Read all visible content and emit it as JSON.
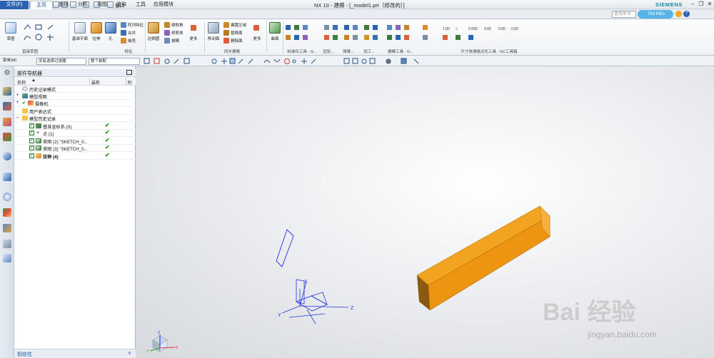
{
  "titlebar": {
    "logo": "NX",
    "title": "NX 10 - 建模 - [_model1.prt（修改的）]",
    "brand": "SIEMENS",
    "window_menu": "窗口"
  },
  "tabs": [
    "文件(F)",
    "主页",
    "曲线",
    "分析",
    "视图",
    "渲染",
    "工具",
    "应用模块"
  ],
  "command_finder_placeholder": "查找命令",
  "net_speed": "763 KB/s",
  "ribbon": {
    "sketch_group": {
      "items": [
        "草图"
      ],
      "label": "直接草图"
    },
    "feature_group": {
      "big": [
        "基准平面",
        "拉伸",
        "孔"
      ],
      "small": [
        "阵列特征",
        "合并",
        "抽壳"
      ],
      "label": "特征"
    },
    "sync_group": {
      "big": [
        "边倒圆",
        "移动面",
        "更多"
      ],
      "small": [
        "倒斜角",
        "修剪体",
        "拔模",
        "偏置区域",
        "替换面",
        "删除面"
      ],
      "label": "同步建模"
    },
    "surface_group": {
      "big": [
        "曲面",
        "更多"
      ]
    },
    "group_labels": [
      "标准化工具 - G...",
      "齿轮...",
      "弹簧...",
      "加工...",
      "建模工具 - G...",
      "尺寸快速格式化工具 - GC工具箱"
    ]
  },
  "toolbar": {
    "menu_label": "菜单(M)",
    "filter_value": "没有选择过滤器",
    "assembly_value": "整个装配"
  },
  "navigator": {
    "title": "部件导航器",
    "columns": [
      "名称",
      "最新",
      "附"
    ],
    "rows": [
      {
        "label": "历史记录模式",
        "indent": 0,
        "latest": false
      },
      {
        "label": "模型视图",
        "indent": 0,
        "latest": false
      },
      {
        "label": "摄像机",
        "indent": 0,
        "latest": false
      },
      {
        "label": "用户表达式",
        "indent": 0,
        "latest": false
      },
      {
        "label": "模型历史记录",
        "indent": 0,
        "latest": false
      },
      {
        "label": "基准坐标系 (0)",
        "indent": 1,
        "latest": true
      },
      {
        "label": "点 (1)",
        "indent": 1,
        "latest": true
      },
      {
        "label": "草图 (2) \"SKETCH_0...",
        "indent": 1,
        "latest": true
      },
      {
        "label": "草图 (3) \"SKETCH_0...",
        "indent": 1,
        "latest": true
      },
      {
        "label": "拉伸 (4)",
        "indent": 1,
        "latest": true
      }
    ],
    "dependency_label": "相依性"
  },
  "viewport": {
    "axis_x": "X",
    "axis_y": "Y",
    "axis_z": "Z",
    "watermark_logo": "Bai 经验",
    "watermark_url": "jingyan.baidu.com"
  },
  "colors": {
    "solid_top": "#f2a321",
    "solid_front": "#ee9413",
    "solid_side": "#8a5a10",
    "sketch": "#2233dd",
    "accent": "#2a63b0"
  }
}
